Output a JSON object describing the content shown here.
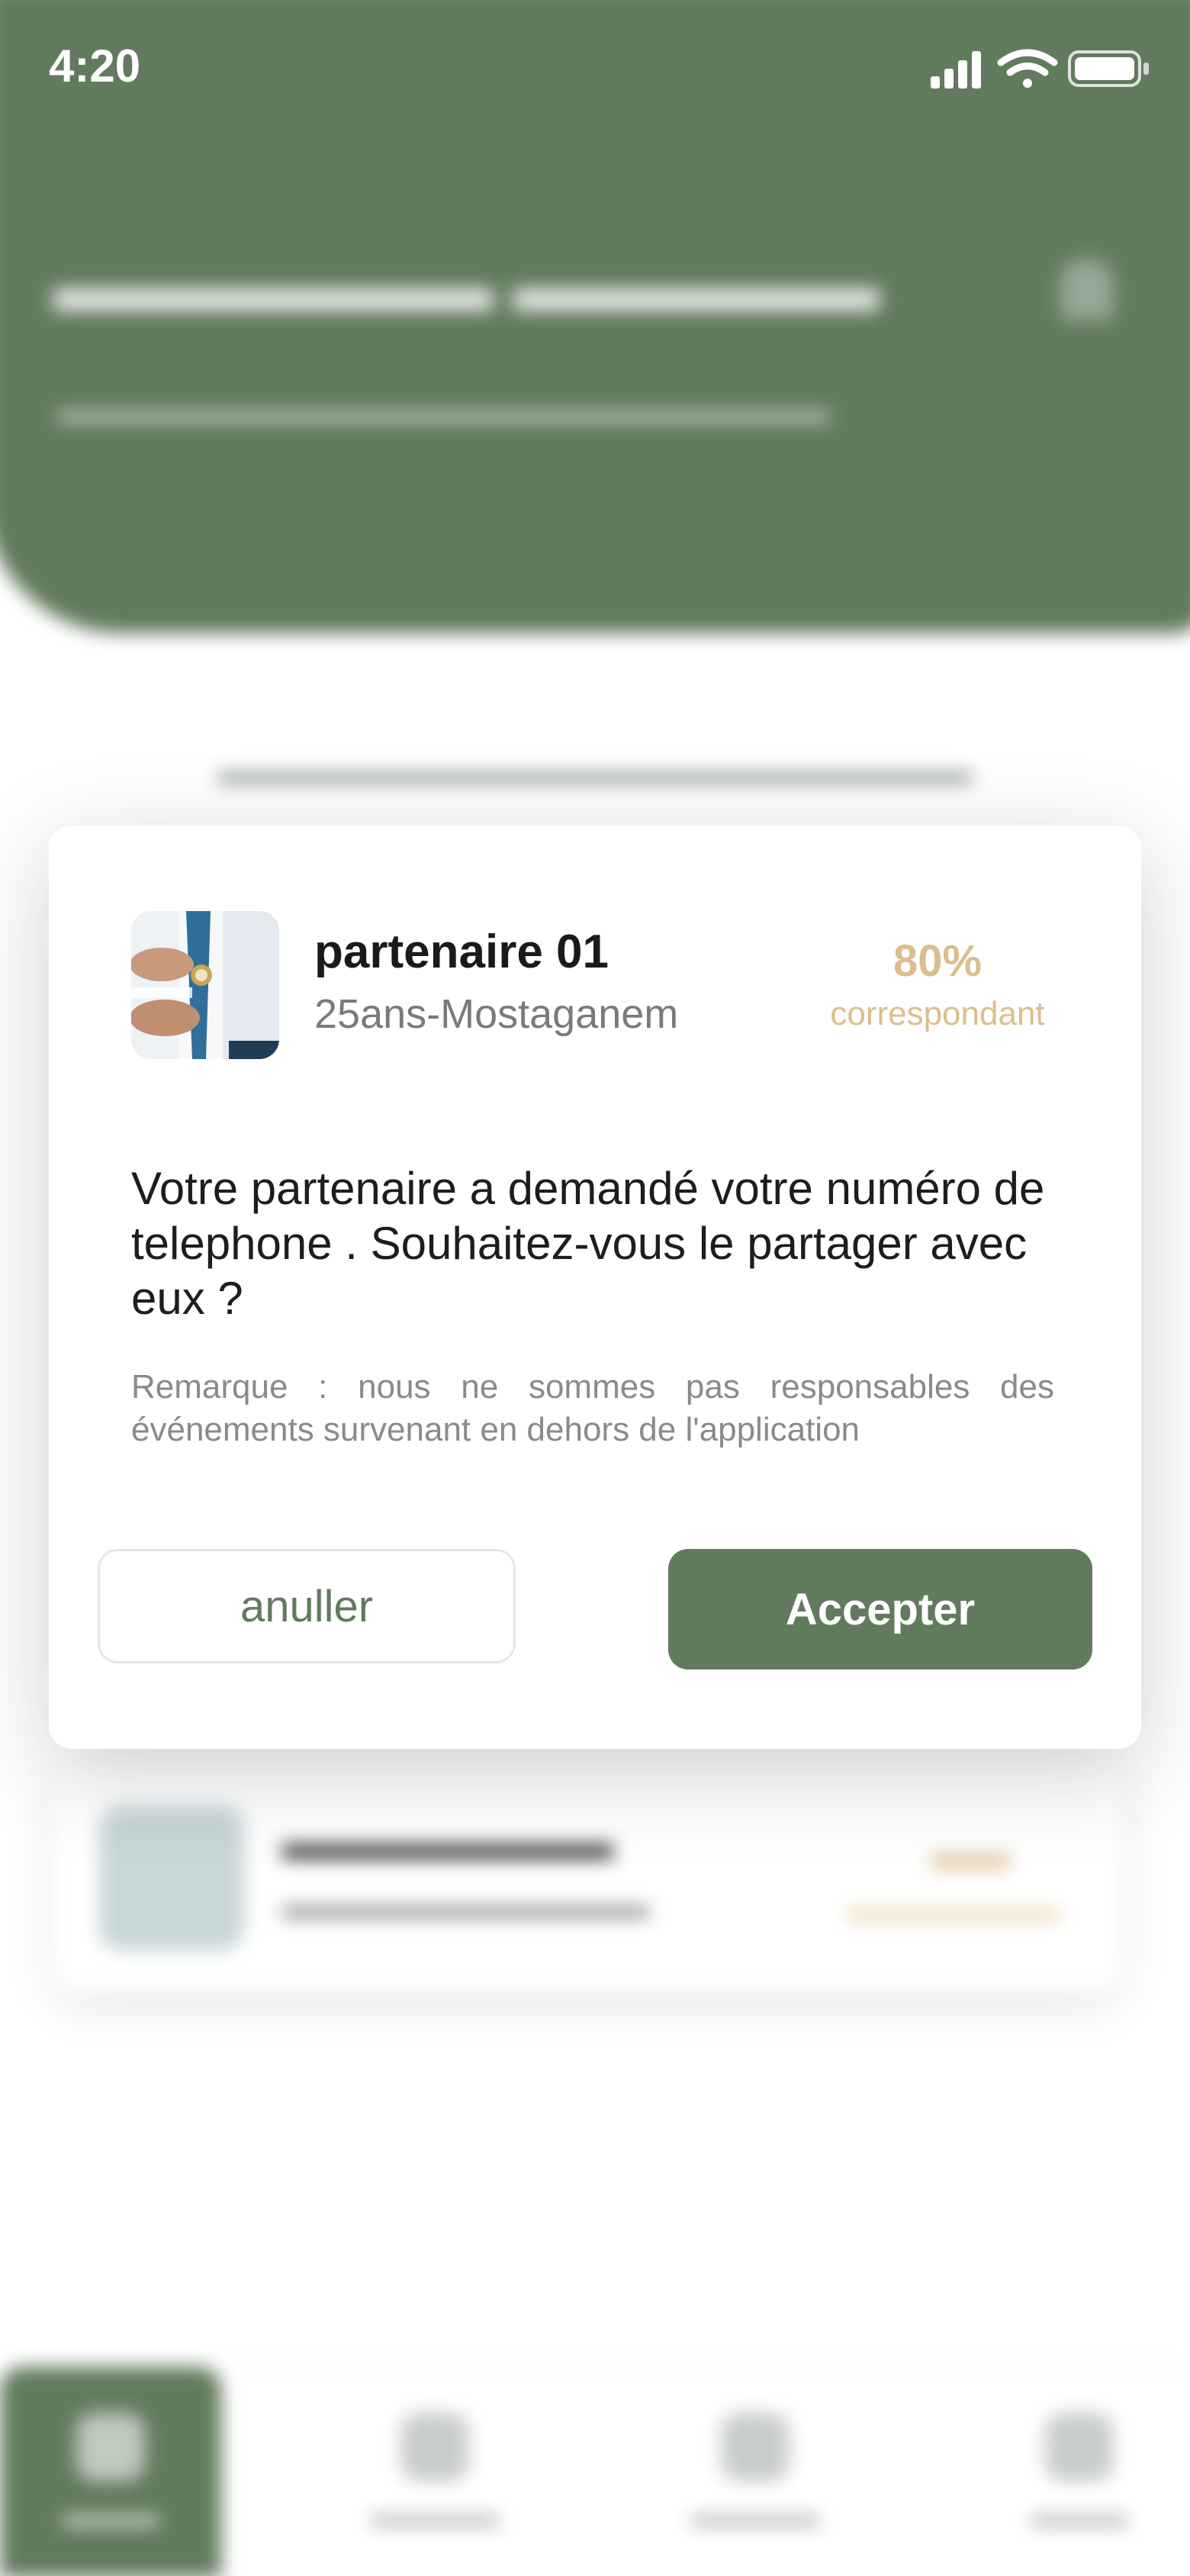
{
  "status_bar": {
    "time": "4:20",
    "icons": [
      "cellular-signal-icon",
      "wifi-icon",
      "battery-icon"
    ]
  },
  "modal": {
    "partner": {
      "name": "partenaire 01",
      "meta": "25ans-Mostaganem",
      "match_percent": "80%",
      "match_label": "correspondant",
      "avatar_icon": "partner-photo-avatar"
    },
    "question": "Votre partenaire a demandé votre numéro de telephone . Souhaitez-vous le partager avec eux ?",
    "note": "Remarque : nous ne sommes pas responsables des événements survenant en dehors de l'application",
    "cancel_label": "anuller",
    "accept_label": "Accepter"
  },
  "colors": {
    "primary_green": "#627a5e",
    "accent_gold": "#dcbd8f",
    "text_dark": "#1a1a1a",
    "text_muted": "#7a7a7a"
  }
}
